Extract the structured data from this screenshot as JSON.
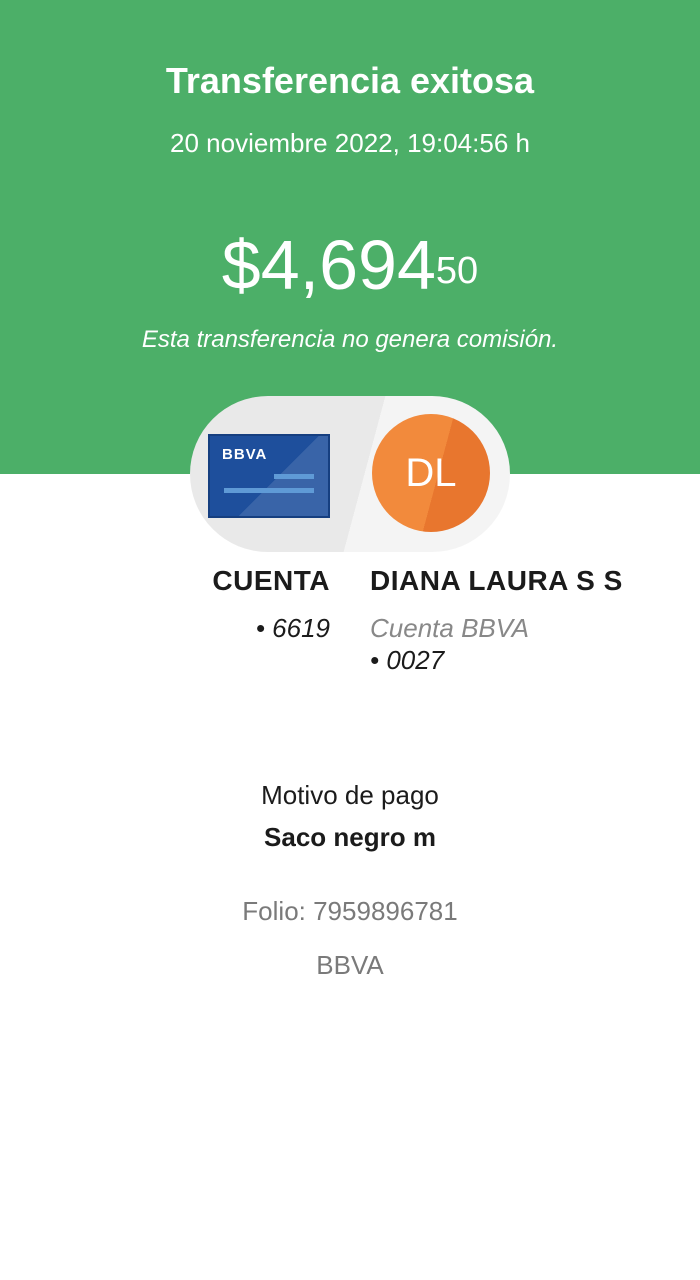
{
  "header": {
    "title": "Transferencia exitosa",
    "datetime": "20 noviembre 2022, 19:04:56 h",
    "amount_main": "$4,694",
    "amount_cents": "50",
    "note": "Esta transferencia no genera comisión."
  },
  "source": {
    "card_logo": "BBVA",
    "label": "CUENTA",
    "account": "• 6619"
  },
  "destination": {
    "initials": "DL",
    "name": "DIANA LAURA S S",
    "bank_label": "Cuenta BBVA",
    "account": "• 0027"
  },
  "details": {
    "motive_label": "Motivo de pago",
    "motive_value": "Saco negro m",
    "folio": "Folio: 7959896781",
    "bank": "BBVA"
  },
  "colors": {
    "header_bg": "#4caf68",
    "card_blue": "#1e4f9c",
    "avatar_orange": "#f28a3c"
  },
  "icons": {
    "card": "bank-card-icon",
    "avatar": "initials-avatar"
  }
}
